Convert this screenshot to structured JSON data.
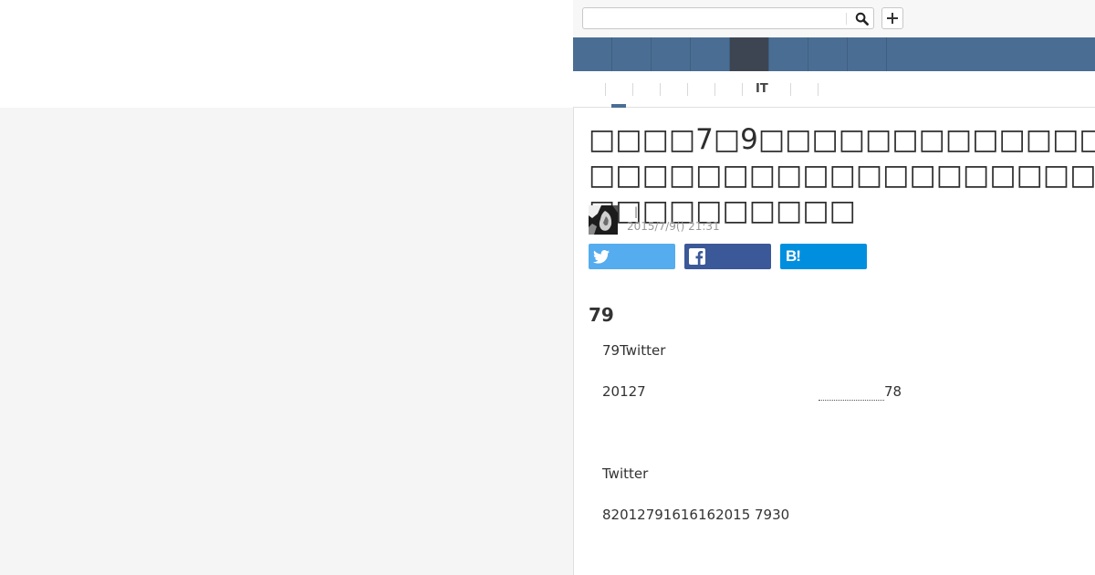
{
  "search": {
    "placeholder": ""
  },
  "subnav": {
    "label": "IT"
  },
  "article": {
    "title": "□□□□7□9□□□□□□□□□□□□□□□□□□□□□□□□□□□□□□□□□□□□□□□□□□□□□",
    "author_separator": "|",
    "date": "2015/7/9() 21:31",
    "share": {
      "hatena_label": "B!"
    },
    "heading": "79",
    "paragraphs": {
      "p1": "79Twitter",
      "p2_start": "20127",
      "p2_end": "78",
      "p3": "Twitter",
      "p4": "82012791616162015 7930"
    }
  },
  "colors": {
    "nav_bar": "#4a6e93",
    "nav_active": "#3d4552",
    "twitter": "#55acee",
    "facebook": "#3b5998",
    "hatena": "#008fde",
    "left_panel": "#f5f5f5"
  },
  "icons": [
    "search-icon",
    "plus-icon",
    "twitter-icon",
    "facebook-icon",
    "hatena-bookmark-icon",
    "avatar"
  ]
}
